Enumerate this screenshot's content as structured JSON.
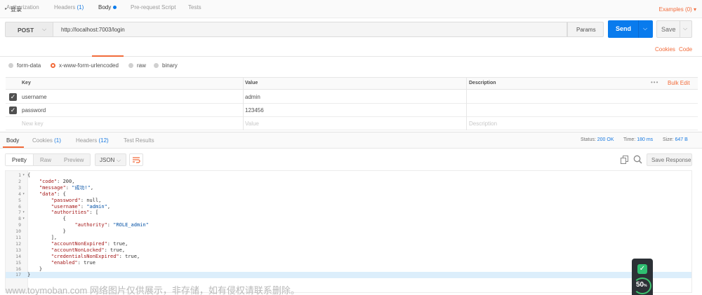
{
  "title_bar": {
    "name": "登录",
    "examples": "Examples (0)"
  },
  "request": {
    "method": "POST",
    "url": "http://localhost:7003/login",
    "params_label": "Params",
    "send_label": "Send",
    "save_label": "Save"
  },
  "req_tabs": [
    {
      "label": "Authorization",
      "count": ""
    },
    {
      "label": "Headers",
      "count": "(1)"
    },
    {
      "label": "Body",
      "count": ""
    },
    {
      "label": "Pre-request Script",
      "count": ""
    },
    {
      "label": "Tests",
      "count": ""
    }
  ],
  "links": {
    "cookies": "Cookies",
    "code": "Code"
  },
  "body_types": [
    "form-data",
    "x-www-form-urlencoded",
    "raw",
    "binary"
  ],
  "kv_table": {
    "headers": {
      "key": "Key",
      "value": "Value",
      "description": "Description"
    },
    "bulk_edit": "Bulk Edit",
    "more": "•••",
    "rows": [
      {
        "key": "username",
        "value": "admin"
      },
      {
        "key": "password",
        "value": "123456"
      }
    ],
    "placeholders": {
      "key": "New key",
      "value": "Value",
      "description": "Description"
    }
  },
  "response": {
    "tabs": [
      {
        "label": "Body",
        "count": ""
      },
      {
        "label": "Cookies",
        "count": "(1)"
      },
      {
        "label": "Headers",
        "count": "(12)"
      },
      {
        "label": "Test Results",
        "count": ""
      }
    ],
    "status_label": "Status:",
    "status_value": "200 OK",
    "time_label": "Time:",
    "time_value": "180 ms",
    "size_label": "Size:",
    "size_value": "647 B",
    "views": [
      "Pretty",
      "Raw",
      "Preview"
    ],
    "format": "JSON",
    "save_response": "Save Response",
    "lines": [
      "{",
      "    \"code\": 200,",
      "    \"message\": \"成功!\",",
      "    \"data\": {",
      "        \"password\": null,",
      "        \"username\": \"admin\",",
      "        \"authorities\": [",
      "            {",
      "                \"authority\": \"ROLE_admin\"",
      "            }",
      "        ],",
      "        \"accountNonExpired\": true,",
      "        \"accountNonLocked\": true,",
      "        \"credentialsNonExpired\": true,",
      "        \"enabled\": true",
      "    }",
      "}"
    ],
    "fold_lines": [
      1,
      4,
      7,
      8
    ]
  },
  "watermark": "www.toymoban.com 网络图片仅供展示，非存储，如有侵权请联系删除。",
  "widget": {
    "value": "50",
    "unit": "%"
  },
  "colors": {
    "accent": "#f26b3a",
    "primary": "#097bed",
    "link": "#1a7ae0"
  }
}
